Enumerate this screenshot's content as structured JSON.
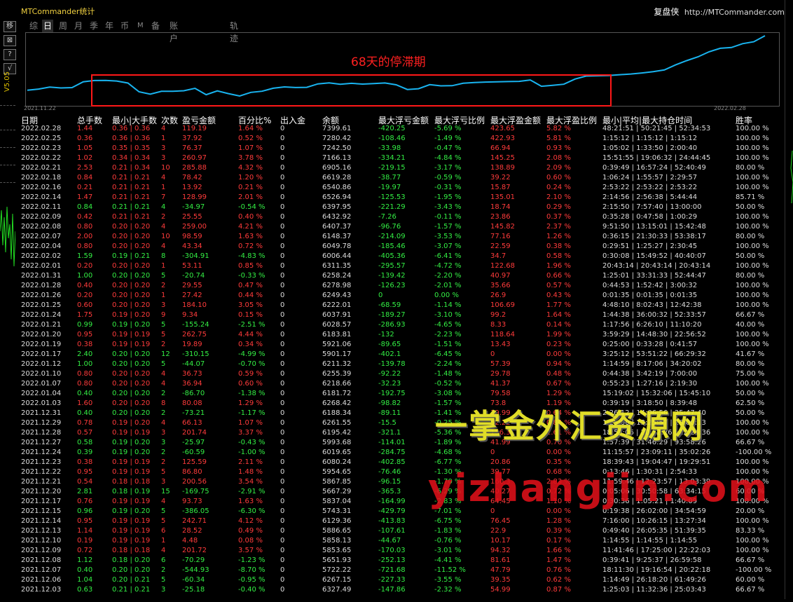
{
  "app_title": "MTCommander统计",
  "brand_cn": "复盘侠",
  "brand_url": "http://MTCommander.com",
  "left_buttons": [
    "移",
    "⊠",
    "?",
    "√"
  ],
  "version_label": "V5.05",
  "tabs": [
    "综",
    "日",
    "周",
    "月",
    "季",
    "年",
    "币",
    "M",
    "备",
    "账户",
    "轨迹"
  ],
  "active_tab": "日",
  "chart": {
    "start_date": "2021.11.22",
    "end_date": "2022.02.28",
    "annotation": "68天的停滞期",
    "line_color": "#19b4f0",
    "annotation_color": "#ff1818"
  },
  "chart_data": {
    "type": "line",
    "x": [
      0,
      1,
      2,
      3,
      4,
      5,
      6,
      7,
      8,
      9,
      10,
      11,
      12,
      13,
      14,
      15,
      16,
      17,
      18,
      19,
      20,
      21,
      22,
      23,
      24,
      25,
      26,
      27,
      28,
      29,
      30,
      31,
      32,
      33,
      34,
      35,
      36,
      37,
      38,
      39,
      40,
      41,
      42,
      43,
      44,
      45,
      46,
      47,
      48,
      49,
      50,
      51,
      52,
      53,
      54,
      55,
      56,
      57,
      58,
      59,
      60,
      61,
      62,
      63,
      64,
      65,
      66,
      67,
      68,
      69,
      70,
      71,
      72,
      73,
      74,
      75,
      76,
      77,
      78,
      79,
      80
    ],
    "values": [
      6318,
      6340,
      6379,
      6363,
      6370,
      6486,
      6510,
      6512,
      6500,
      6460,
      6286,
      6240,
      6296,
      6298,
      6307,
      6356,
      6230,
      6305,
      6250,
      6203,
      6276,
      6298,
      6358,
      6384,
      6371,
      6376,
      6444,
      6464,
      6437,
      6455,
      6439,
      6451,
      6462,
      6425,
      6333,
      6347,
      6428,
      6404,
      6407,
      6456,
      6470,
      6480,
      6484,
      6489,
      6493,
      6522,
      6396,
      6415,
      6437,
      6540,
      6600,
      6605,
      6611,
      6626,
      6640,
      6660,
      6685,
      6720,
      6820,
      6905,
      6980,
      7080,
      7150,
      7166,
      7242,
      7280,
      7399
    ],
    "title": "",
    "xlabel": "",
    "ylabel": "",
    "grid": false
  },
  "table": {
    "headers": [
      "日期",
      "总手数",
      "最小|大手数",
      "次数",
      "盈亏金额",
      "百分比%",
      "出入金",
      "余额",
      "最大浮亏金额",
      "最大浮亏比例",
      "最大浮盈金额",
      "最大浮盈比例",
      "最小|平均|最大持仓时间",
      "胜率"
    ],
    "rows": [
      [
        "2022.02.28",
        "1.44",
        "0.36 | 0.36",
        "4",
        "119.19",
        "1.64 %",
        "0",
        "7399.61",
        "-420.25",
        "-5.69 %",
        "423.65",
        "5.82 %",
        "48:21:51 | 50:21:45 | 52:34:53",
        "100.00 %"
      ],
      [
        "2022.02.25",
        "0.36",
        "0.36 | 0.36",
        "1",
        "37.92",
        "0.52 %",
        "0",
        "7280.42",
        "-108.46",
        "-1.49 %",
        "422.93",
        "5.81 %",
        "1:15:12 | 1:15:12 | 1:15:12",
        "100.00 %"
      ],
      [
        "2022.02.23",
        "1.05",
        "0.35 | 0.35",
        "3",
        "76.37",
        "1.07 %",
        "0",
        "7242.50",
        "-33.98",
        "-0.47 %",
        "66.94",
        "0.93 %",
        "1:05:02 | 1:33:50 | 2:00:40",
        "100.00 %"
      ],
      [
        "2022.02.22",
        "1.02",
        "0.34 | 0.34",
        "3",
        "260.97",
        "3.78 %",
        "0",
        "7166.13",
        "-334.21",
        "-4.84 %",
        "145.25",
        "2.08 %",
        "15:51:55 | 19:06:32 | 24:44:45",
        "100.00 %"
      ],
      [
        "2022.02.21",
        "2.53",
        "0.21 | 0.34",
        "10",
        "285.88",
        "4.32 %",
        "0",
        "6905.16",
        "-219.15",
        "-3.17 %",
        "138.89",
        "2.09 %",
        "0:39:49 | 16:57:24 | 52:40:49",
        "80.00 %"
      ],
      [
        "2022.02.18",
        "0.84",
        "0.21 | 0.21",
        "4",
        "78.42",
        "1.20 %",
        "0",
        "6619.28",
        "-38.77",
        "-0.59 %",
        "39.22",
        "0.60 %",
        "1:06:24 | 1:55:57 | 2:29:57",
        "100.00 %"
      ],
      [
        "2022.02.16",
        "0.21",
        "0.21 | 0.21",
        "1",
        "13.92",
        "0.21 %",
        "0",
        "6540.86",
        "-19.97",
        "-0.31 %",
        "15.87",
        "0.24 %",
        "2:53:22 | 2:53:22 | 2:53:22",
        "100.00 %"
      ],
      [
        "2022.02.14",
        "1.47",
        "0.21 | 0.21",
        "7",
        "128.99",
        "2.01 %",
        "0",
        "6526.94",
        "-125.53",
        "-1.95 %",
        "135.01",
        "2.10 %",
        "2:14:56 | 2:56:38 | 5:44:44",
        "85.71 %"
      ],
      [
        "2022.02.11",
        "0.84",
        "0.21 | 0.21",
        "4",
        "-34.97",
        "-0.54 %",
        "0",
        "6397.95",
        "-221.29",
        "-3.43 %",
        "18.74",
        "0.29 %",
        "2:15:50 | 7:57:40 | 13:00:00",
        "50.00 %"
      ],
      [
        "2022.02.09",
        "0.42",
        "0.21 | 0.21",
        "2",
        "25.55",
        "0.40 %",
        "0",
        "6432.92",
        "-7.26",
        "-0.11 %",
        "23.86",
        "0.37 %",
        "0:35:28 | 0:47:58 | 1:00:29",
        "100.00 %"
      ],
      [
        "2022.02.08",
        "0.80",
        "0.20 | 0.20",
        "4",
        "259.00",
        "4.21 %",
        "0",
        "6407.37",
        "-96.76",
        "-1.57 %",
        "145.82",
        "2.37 %",
        "9:51:50 | 13:15:01 | 15:42:48",
        "100.00 %"
      ],
      [
        "2022.02.07",
        "2.00",
        "0.20 | 0.20",
        "10",
        "98.59",
        "1.63 %",
        "0",
        "6148.37",
        "-214.09",
        "-3.53 %",
        "77.16",
        "1.26 %",
        "0:36:15 | 21:30:33 | 53:38:17",
        "80.00 %"
      ],
      [
        "2022.02.04",
        "0.80",
        "0.20 | 0.20",
        "4",
        "43.34",
        "0.72 %",
        "0",
        "6049.78",
        "-185.46",
        "-3.07 %",
        "22.59",
        "0.38 %",
        "0:29:51 | 1:25:27 | 2:30:45",
        "100.00 %"
      ],
      [
        "2022.02.02",
        "1.59",
        "0.19 | 0.21",
        "8",
        "-304.91",
        "-4.83 %",
        "0",
        "6006.44",
        "-405.36",
        "-6.41 %",
        "34.7",
        "0.58 %",
        "0:30:08 | 15:49:52 | 40:40:07",
        "50.00 %"
      ],
      [
        "2022.02.01",
        "0.20",
        "0.20 | 0.20",
        "1",
        "53.11",
        "0.85 %",
        "0",
        "6311.35",
        "-295.57",
        "-4.72 %",
        "122.68",
        "1.96 %",
        "20:43:14 | 20:43:14 | 20:43:14",
        "100.00 %"
      ],
      [
        "2022.01.31",
        "1.00",
        "0.20 | 0.20",
        "5",
        "-20.74",
        "-0.33 %",
        "0",
        "6258.24",
        "-139.42",
        "-2.20 %",
        "40.97",
        "0.66 %",
        "1:25:01 | 33:31:33 | 52:44:47",
        "80.00 %"
      ],
      [
        "2022.01.28",
        "0.40",
        "0.20 | 0.20",
        "2",
        "29.55",
        "0.47 %",
        "0",
        "6278.98",
        "-126.23",
        "-2.01 %",
        "35.66",
        "0.57 %",
        "0:44:53 | 1:52:42 | 3:00:32",
        "100.00 %"
      ],
      [
        "2022.01.26",
        "0.20",
        "0.20 | 0.20",
        "1",
        "27.42",
        "0.44 %",
        "0",
        "6249.43",
        "0",
        "0.00 %",
        "26.9",
        "0.43 %",
        "0:01:35 | 0:01:35 | 0:01:35",
        "100.00 %"
      ],
      [
        "2022.01.25",
        "0.60",
        "0.20 | 0.20",
        "3",
        "184.10",
        "3.05 %",
        "0",
        "6222.01",
        "-68.59",
        "-1.14 %",
        "106.69",
        "1.77 %",
        "4:48:10 | 8:02:43 | 12:42:38",
        "100.00 %"
      ],
      [
        "2022.01.24",
        "1.75",
        "0.19 | 0.20",
        "9",
        "9.34",
        "0.15 %",
        "0",
        "6037.91",
        "-189.27",
        "-3.10 %",
        "99.2",
        "1.64 %",
        "1:44:38 | 36:00:32 | 52:33:57",
        "66.67 %"
      ],
      [
        "2022.01.21",
        "0.99",
        "0.19 | 0.20",
        "5",
        "-155.24",
        "-2.51 %",
        "0",
        "6028.57",
        "-286.93",
        "-4.65 %",
        "8.33",
        "0.14 %",
        "1:17:56 | 6:26:10 | 11:10:20",
        "40.00 %"
      ],
      [
        "2022.01.20",
        "0.95",
        "0.19 | 0.19",
        "5",
        "262.75",
        "4.44 %",
        "0",
        "6183.81",
        "-132",
        "-2.23 %",
        "118.64",
        "1.99 %",
        "3:59:29 | 14:48:30 | 22:56:52",
        "100.00 %"
      ],
      [
        "2022.01.19",
        "0.38",
        "0.19 | 0.19",
        "2",
        "19.89",
        "0.34 %",
        "0",
        "5921.06",
        "-89.65",
        "-1.51 %",
        "13.43",
        "0.23 %",
        "0:25:00 | 0:33:28 | 0:41:57",
        "100.00 %"
      ],
      [
        "2022.01.17",
        "2.40",
        "0.20 | 0.20",
        "12",
        "-310.15",
        "-4.99 %",
        "0",
        "5901.17",
        "-402.1",
        "-6.45 %",
        "0",
        "0.00 %",
        "3:25:12 | 53:51:22 | 66:29:32",
        "41.67 %"
      ],
      [
        "2022.01.12",
        "1.00",
        "0.20 | 0.20",
        "5",
        "-44.07",
        "-0.70 %",
        "0",
        "6211.32",
        "-139.78",
        "-2.24 %",
        "57.39",
        "0.94 %",
        "1:14:59 | 8:17:06 | 34:20:02",
        "80.00 %"
      ],
      [
        "2022.01.10",
        "0.80",
        "0.20 | 0.20",
        "4",
        "36.73",
        "0.59 %",
        "0",
        "6255.39",
        "-92.22",
        "-1.48 %",
        "29.78",
        "0.48 %",
        "0:44:38 | 3:42:19 | 7:00:00",
        "75.00 %"
      ],
      [
        "2022.01.07",
        "0.80",
        "0.20 | 0.20",
        "4",
        "36.94",
        "0.60 %",
        "0",
        "6218.66",
        "-32.23",
        "-0.52 %",
        "41.37",
        "0.67 %",
        "0:55:23 | 1:27:16 | 2:19:30",
        "100.00 %"
      ],
      [
        "2022.01.04",
        "0.40",
        "0.20 | 0.20",
        "2",
        "-86.70",
        "-1.38 %",
        "0",
        "6181.72",
        "-192.75",
        "-3.08 %",
        "79.58",
        "1.29 %",
        "15:19:02 | 15:32:06 | 15:45:10",
        "50.00 %"
      ],
      [
        "2022.01.03",
        "1.60",
        "0.20 | 0.20",
        "8",
        "80.08",
        "1.29 %",
        "0",
        "6268.42",
        "-98.82",
        "-1.57 %",
        "73.8",
        "1.19 %",
        "0:39:19 | 3:18:50 | 8:39:48",
        "62.50 %"
      ],
      [
        "2021.12.31",
        "0.40",
        "0.20 | 0.20",
        "2",
        "-73.21",
        "-1.17 %",
        "0",
        "6188.34",
        "-89.11",
        "-1.41 %",
        "39.99",
        "0.64 %",
        "2:26:12 | 14:06:56 | 25:47:40",
        "50.00 %"
      ],
      [
        "2021.12.29",
        "0.78",
        "0.19 | 0.20",
        "4",
        "66.13",
        "1.07 %",
        "0",
        "6261.55",
        "-15.5",
        "-0.25 %",
        "52.22",
        "0.84 %",
        "1:25:00 | 13:25:57 | 26:00:13",
        "100.00 %"
      ],
      [
        "2021.12.28",
        "0.57",
        "0.19 | 0.19",
        "3",
        "201.74",
        "3.37 %",
        "0",
        "6195.42",
        "-321.1",
        "-5.36 %",
        "156.3",
        "2.61 %",
        "18:52:06 | 20:52:26 | 22:24:36",
        "100.00 %"
      ],
      [
        "2021.12.27",
        "0.58",
        "0.19 | 0.20",
        "3",
        "-25.97",
        "-0.43 %",
        "0",
        "5993.68",
        "-114.01",
        "-1.89 %",
        "41.99",
        "0.70 %",
        "1:57:39 | 31:46:29 | 93:58:26",
        "66.67 %"
      ],
      [
        "2021.12.24",
        "0.39",
        "0.19 | 0.20",
        "2",
        "-60.59",
        "-1.00 %",
        "0",
        "6019.65",
        "-284.75",
        "-4.68 %",
        "0",
        "0.00 %",
        "11:15:57 | 23:09:11 | 35:02:26",
        "-100.00 %"
      ],
      [
        "2021.12.23",
        "0.38",
        "0.19 | 0.19",
        "2",
        "125.59",
        "2.11 %",
        "0",
        "6080.24",
        "-402.85",
        "-6.77 %",
        "20.86",
        "0.35 %",
        "18:39:43 | 19:04:47 | 19:29:51",
        "100.00 %"
      ],
      [
        "2021.12.22",
        "0.95",
        "0.19 | 0.19",
        "5",
        "86.80",
        "1.48 %",
        "0",
        "5954.65",
        "-76.46",
        "-1.30 %",
        "39.77",
        "0.68 %",
        "0:13:46 | 1:30:31 | 2:54:33",
        "100.00 %"
      ],
      [
        "2021.12.21",
        "0.54",
        "0.18 | 0.18",
        "3",
        "200.56",
        "3.54 %",
        "0",
        "5867.85",
        "-96.15",
        "-1.70 %",
        "160.3",
        "2.83 %",
        "11:59:46 | 12:23:57 | 13:03:39",
        "100.00 %"
      ],
      [
        "2021.12.20",
        "2.81",
        "0.18 | 0.19",
        "15",
        "-169.75",
        "-2.91 %",
        "0",
        "5667.29",
        "-365.3",
        "-6.29 %",
        "40.27",
        "0.72 %",
        "0:05:06 | 30:50:58 | 63:34:15",
        "60.00 %"
      ],
      [
        "2021.12.17",
        "0.76",
        "0.19 | 0.19",
        "4",
        "93.73",
        "1.63 %",
        "0",
        "5837.04",
        "-164.99",
        "-2.83 %",
        "64.45",
        "1.10 %",
        "0:30:36 | 1:05:21 | 1:40:09",
        "100.00 %"
      ],
      [
        "2021.12.15",
        "0.96",
        "0.19 | 0.20",
        "5",
        "-386.05",
        "-6.30 %",
        "0",
        "5743.31",
        "-429.79",
        "-7.01 %",
        "0",
        "0.00 %",
        "0:19:38 | 26:02:00 | 34:54:59",
        "20.00 %"
      ],
      [
        "2021.12.14",
        "0.95",
        "0.19 | 0.19",
        "5",
        "242.71",
        "4.12 %",
        "0",
        "6129.36",
        "-413.83",
        "-6.75 %",
        "76.45",
        "1.28 %",
        "7:16:00 | 10:26:15 | 13:27:34",
        "100.00 %"
      ],
      [
        "2021.12.13",
        "1.14",
        "0.19 | 0.19",
        "6",
        "28.52",
        "0.49 %",
        "0",
        "5886.65",
        "-107.61",
        "-1.83 %",
        "22.9",
        "0.39 %",
        "0:49:40 | 26:05:35 | 51:39:35",
        "83.33 %"
      ],
      [
        "2021.12.10",
        "0.19",
        "0.19 | 0.19",
        "1",
        "4.48",
        "0.08 %",
        "0",
        "5858.13",
        "-44.67",
        "-0.76 %",
        "10.17",
        "0.17 %",
        "1:14:55 | 1:14:55 | 1:14:55",
        "100.00 %"
      ],
      [
        "2021.12.09",
        "0.72",
        "0.18 | 0.18",
        "4",
        "201.72",
        "3.57 %",
        "0",
        "5853.65",
        "-170.03",
        "-3.01 %",
        "94.32",
        "1.66 %",
        "11:41:46 | 17:25:00 | 22:22:03",
        "100.00 %"
      ],
      [
        "2021.12.08",
        "1.12",
        "0.18 | 0.20",
        "6",
        "-70.29",
        "-1.23 %",
        "0",
        "5651.93",
        "-252.13",
        "-4.41 %",
        "81.61",
        "1.47 %",
        "0:39:41 | 9:25:37 | 26:59:58",
        "66.67 %"
      ],
      [
        "2021.12.07",
        "0.40",
        "0.20 | 0.20",
        "2",
        "-544.93",
        "-8.70 %",
        "0",
        "5722.22",
        "-721.68",
        "-11.52 %",
        "47.79",
        "0.76 %",
        "18:11:30 | 19:16:54 | 20:22:18",
        "-100.00 %"
      ],
      [
        "2021.12.06",
        "1.04",
        "0.20 | 0.21",
        "5",
        "-60.34",
        "-0.95 %",
        "0",
        "6267.15",
        "-227.33",
        "-3.55 %",
        "39.35",
        "0.62 %",
        "1:14:49 | 26:18:20 | 61:49:26",
        "60.00 %"
      ],
      [
        "2021.12.03",
        "0.63",
        "0.21 | 0.21",
        "3",
        "-25.18",
        "-0.40 %",
        "0",
        "6327.49",
        "-147.86",
        "-2.32 %",
        "54.99",
        "0.87 %",
        "1:25:03 | 11:32:36 | 25:03:43",
        "66.67 %"
      ]
    ]
  },
  "watermark_cn": "一掌金外汇资源网",
  "watermark_en": "yizhangjin.com"
}
